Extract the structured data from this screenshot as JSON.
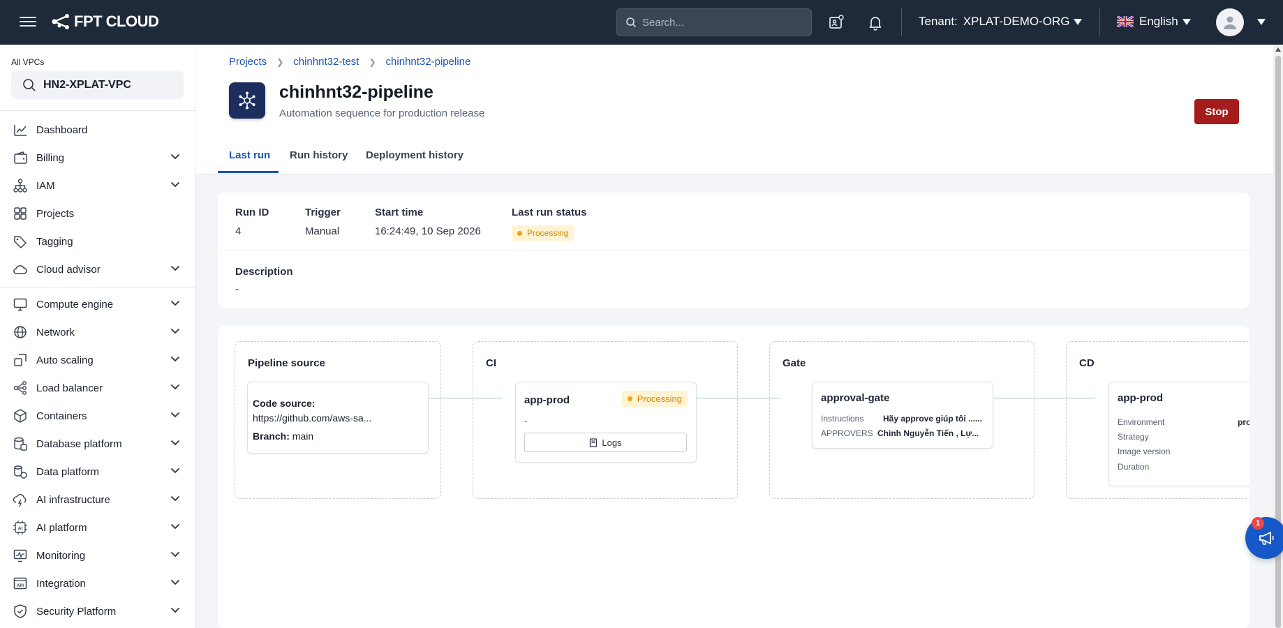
{
  "topbar": {
    "brand": "FPT CLOUD",
    "search_placeholder": "Search...",
    "tenant_label": "Tenant:",
    "tenant_value": "XPLAT-DEMO-ORG",
    "language": "English"
  },
  "sidebar": {
    "vpc_label": "All VPCs",
    "vpc_value": "HN2-XPLAT-VPC",
    "items": [
      {
        "label": "Dashboard",
        "icon": "chart-icon"
      },
      {
        "label": "Billing",
        "icon": "wallet-icon"
      },
      {
        "label": "IAM",
        "icon": "hierarchy-icon"
      },
      {
        "label": "Projects",
        "icon": "grid-icon"
      },
      {
        "label": "Tagging",
        "icon": "tag-icon"
      },
      {
        "label": "Cloud advisor",
        "icon": "cloud-icon"
      },
      {
        "label": "Compute engine",
        "icon": "monitor-icon"
      },
      {
        "label": "Network",
        "icon": "globe-icon"
      },
      {
        "label": "Auto scaling",
        "icon": "scaling-icon"
      },
      {
        "label": "Load balancer",
        "icon": "balancer-icon"
      },
      {
        "label": "Containers",
        "icon": "box-icon"
      },
      {
        "label": "Database platform",
        "icon": "database-icon"
      },
      {
        "label": "Data platform",
        "icon": "data-icon"
      },
      {
        "label": "AI infrastructure",
        "icon": "ai-infra-icon"
      },
      {
        "label": "AI platform",
        "icon": "ai-chip-icon"
      },
      {
        "label": "Monitoring",
        "icon": "monitoring-icon"
      },
      {
        "label": "Integration",
        "icon": "api-icon"
      },
      {
        "label": "Security Platform",
        "icon": "shield-icon"
      }
    ]
  },
  "breadcrumb": [
    "Projects",
    "chinhnt32-test",
    "chinhnt32-pipeline"
  ],
  "pipeline": {
    "title": "chinhnt32-pipeline",
    "subtitle": "Automation sequence for production release",
    "stop_label": "Stop"
  },
  "tabs": [
    "Last run",
    "Run history",
    "Deployment history"
  ],
  "run_info": {
    "run_id_label": "Run ID",
    "run_id": "4",
    "trigger_label": "Trigger",
    "trigger": "Manual",
    "start_label": "Start time",
    "start": "16:24:49, 10 Sep 2026",
    "status_label": "Last run status",
    "status": "Processing",
    "description_label": "Description",
    "description": "-"
  },
  "flow": {
    "source": {
      "title": "Pipeline source",
      "code_label": "Code source:",
      "code_value": "https://github.com/aws-sa...",
      "branch_label": "Branch:",
      "branch_value": "main"
    },
    "ci": {
      "title": "CI",
      "job": "app-prod",
      "status": "Processing",
      "detail": "-",
      "logs_label": "Logs"
    },
    "gate": {
      "title": "Gate",
      "job": "approval-gate",
      "instructions_label": "Instructions",
      "instructions_value": "Hãy approve giúp tôi ......",
      "approvers_label": "APPROVERS",
      "approvers_value": "Chinh Nguyễn Tiến , Lự..."
    },
    "cd": {
      "title": "CD",
      "job": "app-prod",
      "environment_label": "Environment",
      "environment_value": "pro",
      "strategy_label": "Strategy",
      "image_label": "Image version",
      "duration_label": "Duration"
    }
  },
  "notifications": {
    "fab_count": "1"
  },
  "colors": {
    "topbar": "#1e2939",
    "accent": "#1a54b8",
    "stop": "#a51c1c",
    "processing": "#f0a30a"
  }
}
